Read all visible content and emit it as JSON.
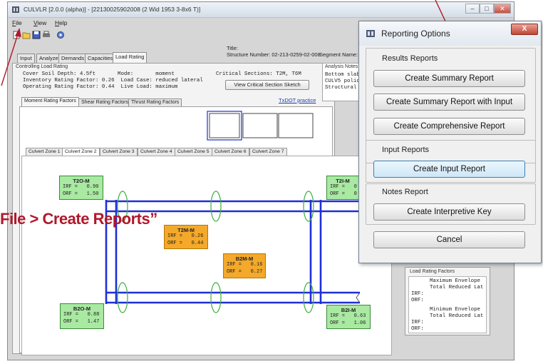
{
  "window": {
    "title": "CULVLR [2.0.0 (alpha)] - [22130025902008 (2 Wid 1953 3-8x6 T)]",
    "icon": "culvert-app-icon",
    "controls": [
      "minimize",
      "maximize",
      "close"
    ]
  },
  "menu": {
    "file": "File",
    "view": "View",
    "help": "Help"
  },
  "toolbar": {
    "icons": [
      "new-icon",
      "open-icon",
      "save-icon",
      "print-icon",
      "settings-icon"
    ]
  },
  "header": {
    "title_label": "Title:",
    "structure_number": "Structure Number: 02-213-0259-02-008",
    "segment_name": "Segment Name:"
  },
  "tabs": [
    "Input",
    "Analyze",
    "Demands",
    "Capacities",
    "Load Rating"
  ],
  "controlling": {
    "group_label": "Controlling Load Rating",
    "lines": [
      "Cover Soil Depth: 4.5ft       Mode:       moment",
      "Inventory Rating Factor: 0.26  Load Case: reduced lateral",
      "Operating Rating Factor: 0.44  Live Load: maximum"
    ],
    "critical_sections": "Critical Sections: T2M, T6M",
    "sketch_button": "View Critical Section Sketch",
    "txdot_link": "TxDOT practice"
  },
  "analysis_notes": {
    "label": "Analysis Notes",
    "lines": [
      "Bottom slab",
      "CULV5 polic",
      "Structural"
    ]
  },
  "factor_tabs": [
    "Moment Rating Factors",
    "Shear Rating Factors",
    "Thrust Rating Factors"
  ],
  "zone_tabs": [
    "Culvert Zone 1",
    "Culvert Zone 2",
    "Culvert Zone 3",
    "Culvert Zone 4",
    "Culvert Zone 5",
    "Culvert Zone 6",
    "Culvert Zone 7"
  ],
  "rating_boxes": [
    {
      "id": "T2O-M",
      "irf": "IRF =   0.90",
      "orf": "ORF =   1.50",
      "color": "#a9e9a2"
    },
    {
      "id": "T2M-M",
      "irf": "IRF =   0.26",
      "orf": "ORF =   0.44",
      "color": "#f4a92a"
    },
    {
      "id": "B2M-M",
      "irf": "IRF =   0.16",
      "orf": "ORF =   0.27",
      "color": "#f4a92a"
    },
    {
      "id": "B2O-M",
      "irf": "IRF =   0.88",
      "orf": "ORF =   1.47",
      "color": "#a9e9a2"
    },
    {
      "id": "T2I-M",
      "irf": "IRF =   0",
      "orf": "ORF =   0",
      "color": "#a9e9a2"
    },
    {
      "id": "B2I-M",
      "irf": "IRF =   0.63",
      "orf": "ORF =   1.06",
      "color": "#a9e9a2"
    }
  ],
  "load_rating_factors": {
    "label": "Load Rating Factors",
    "lines": [
      "Maximum Envelope",
      "Total Reduced Lat",
      "IRF:",
      "ORF:",
      "Minimum Envelope",
      "Total Reduced Lat",
      "IRF:",
      "ORF:"
    ]
  },
  "annotation": "File > Create Reports”",
  "dialog": {
    "title": "Reporting Options",
    "close": "X",
    "results_header": "Results Reports",
    "buttons": {
      "summary": "Create Summary Report",
      "summary_input": "Create Summary Report with Input",
      "comprehensive": "Create Comprehensive Report",
      "input": "Create Input Report",
      "interpretive": "Create Interpretive Key",
      "cancel": "Cancel"
    },
    "input_header": "Input Reports",
    "notes_header": "Notes Report"
  },
  "colors": {
    "frame": "#1f2fd6",
    "ovals": "#3cae3c",
    "arrow": "#b0182b",
    "annotation": "#b0182b"
  }
}
